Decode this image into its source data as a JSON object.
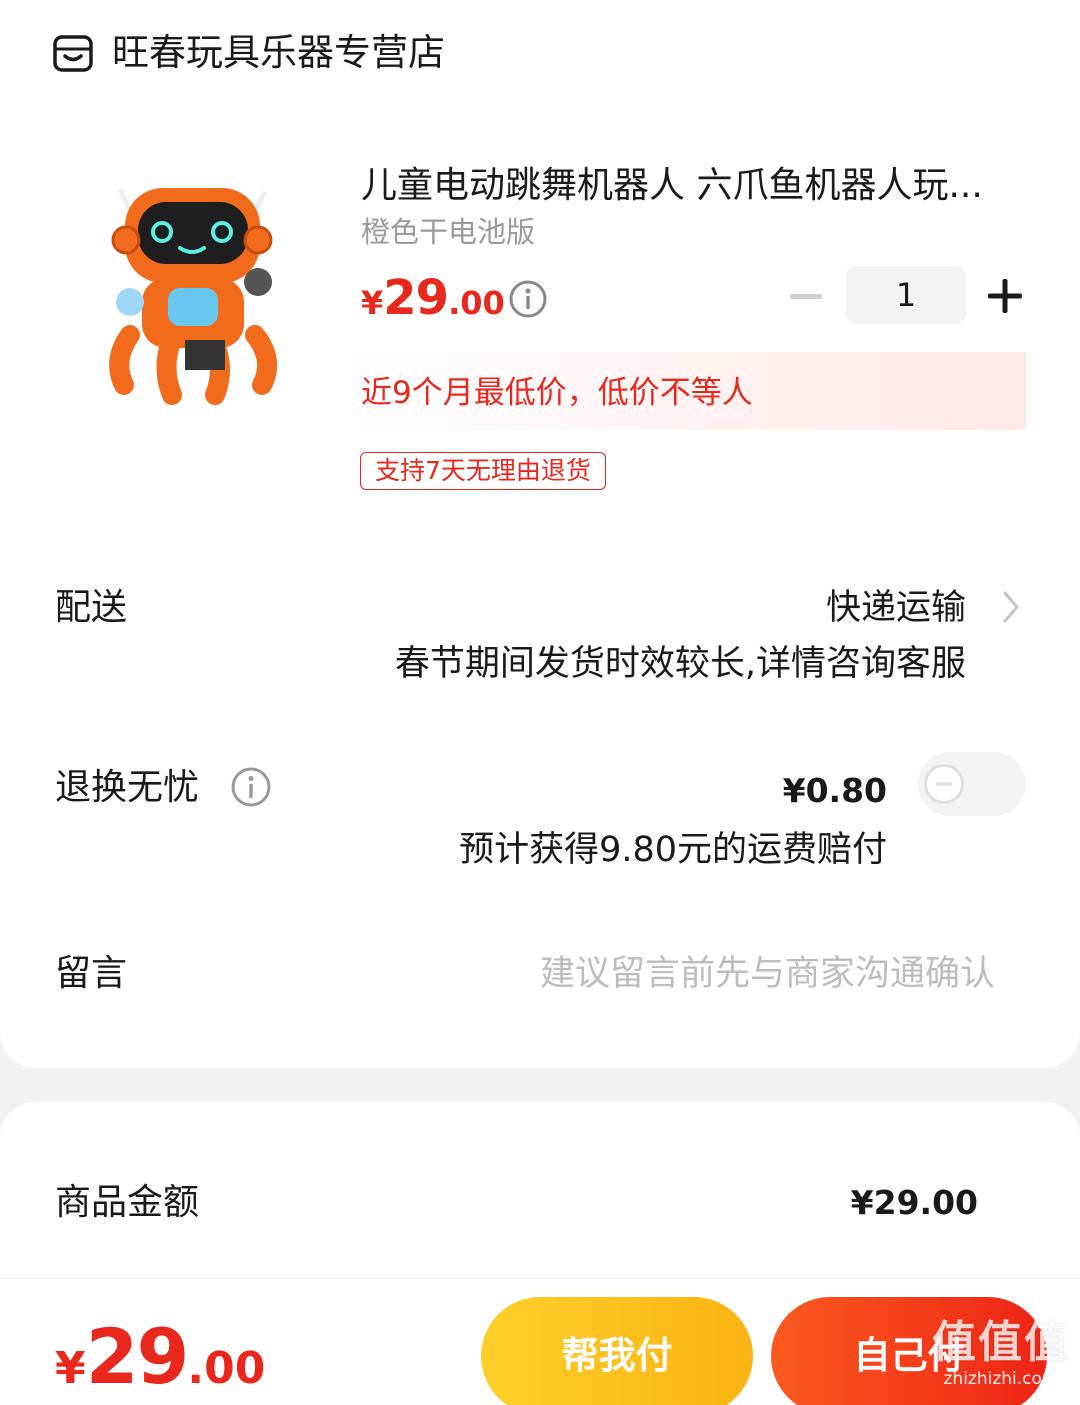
{
  "shop": {
    "name": "旺春玩具乐器专营店",
    "icon": "store-icon"
  },
  "product": {
    "title": "儿童电动跳舞机器人 六爪鱼机器人玩...",
    "variant": "橙色干电池版",
    "price_currency": "¥",
    "price_int": "29",
    "price_dec": ".00",
    "quantity": "1",
    "lowest_price_note": "近9个月最低价，低价不等人",
    "return_tag": "支持7天无理由退货",
    "image": "orange-six-leg-robot-toy"
  },
  "delivery": {
    "label": "配送",
    "value": "快递运输",
    "note": "春节期间发货时效较长,详情咨询客服"
  },
  "worry_free": {
    "label": "退换无忧",
    "price": "¥0.80",
    "note": "预计获得9.80元的运费赔付",
    "enabled": false
  },
  "message": {
    "label": "留言",
    "placeholder": "建议留言前先与商家沟通确认"
  },
  "summary": {
    "subtotal_label": "商品金额",
    "subtotal_value": "¥29.00"
  },
  "footer": {
    "total_currency": "¥",
    "total_int": "29",
    "total_dec": ".00",
    "help_pay_label": "帮我付",
    "self_pay_label": "自己付"
  },
  "watermark": {
    "main": "值值值",
    "sub": "zhizhizhi.com"
  },
  "colors": {
    "accent_red": "#e8281d",
    "help_yellow": "#fbb312",
    "pay_red": "#ee2416"
  }
}
